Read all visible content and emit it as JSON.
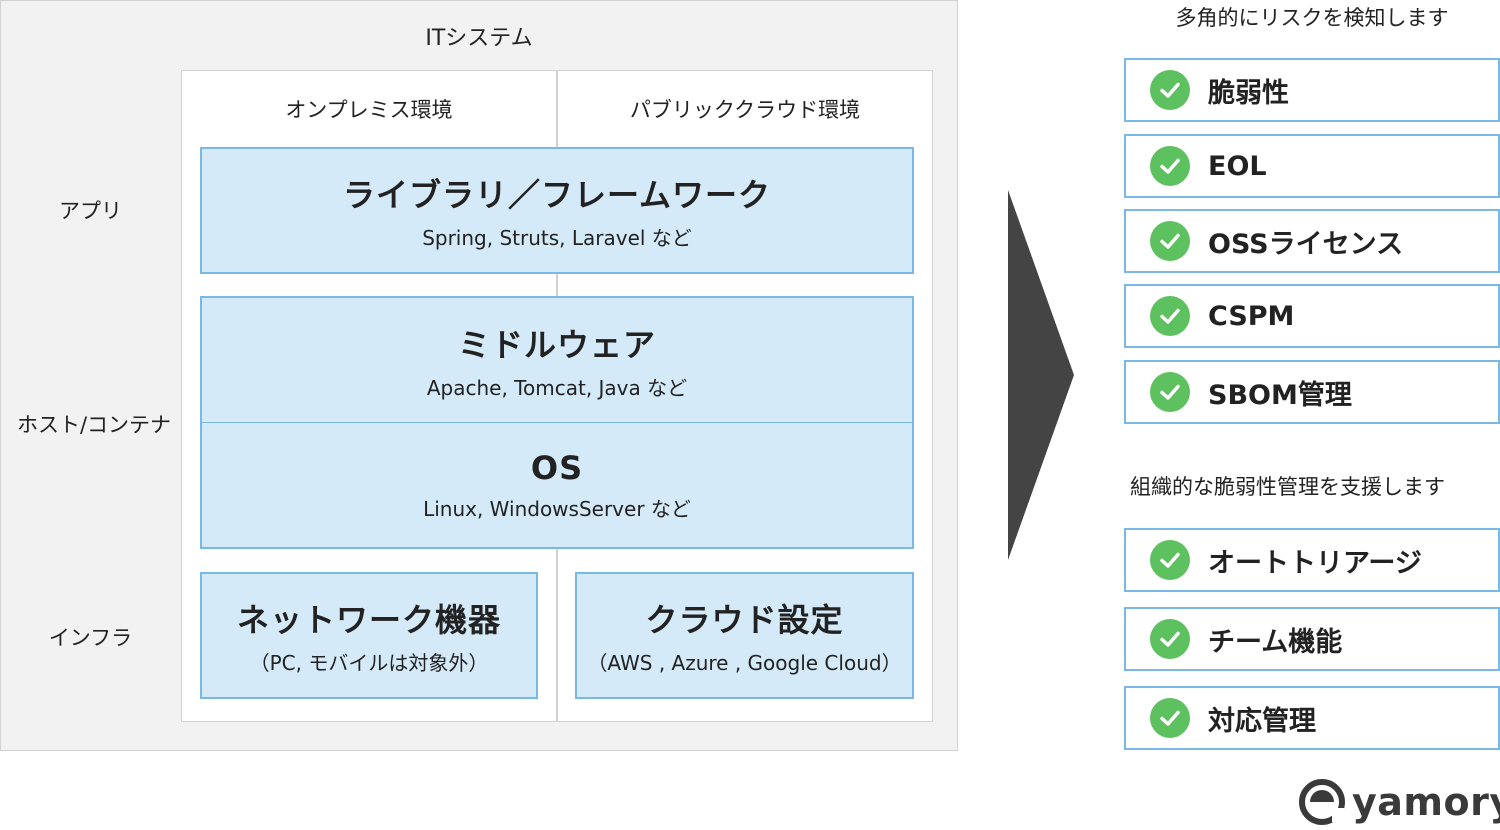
{
  "it_system": {
    "title": "ITシステム",
    "environments": [
      "オンプレミス環境",
      "パブリッククラウド環境"
    ],
    "rows": [
      "アプリ",
      "ホスト/コンテナ",
      "インフラ"
    ],
    "boxes": {
      "library": {
        "title": "ライブラリ／フレームワーク",
        "sub": "Spring, Struts, Laravel など"
      },
      "middleware": {
        "title": "ミドルウェア",
        "sub": "Apache, Tomcat, Java など"
      },
      "os": {
        "title": "OS",
        "sub": "Linux, WindowsServer など"
      },
      "network": {
        "title": "ネットワーク機器",
        "sub": "（PC, モバイルは対象外）"
      },
      "cloud": {
        "title": "クラウド設定",
        "sub": "（AWS , Azure , Google Cloud）"
      }
    }
  },
  "detection": {
    "heading": "多角的にリスクを検知します",
    "items": [
      "脆弱性",
      "EOL",
      "OSSライセンス",
      "CSPM",
      "SBOM管理"
    ]
  },
  "management": {
    "heading": "組織的な脆弱性管理を支援します",
    "items": [
      "オートトリアージ",
      "チーム機能",
      "対応管理"
    ]
  },
  "logo": {
    "text": "yamory"
  },
  "colors": {
    "box_fill": "#d4eaf8",
    "box_border": "#78b9e6",
    "check": "#5ec15f",
    "arrow": "#444444"
  }
}
